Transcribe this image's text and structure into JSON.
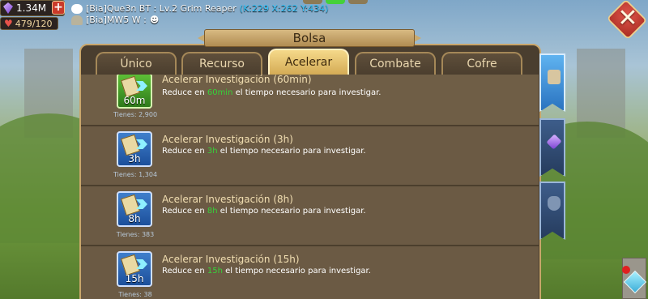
{
  "hud": {
    "gems_value": "1.34M",
    "stamina_value": "479/120"
  },
  "chat": [
    {
      "user": "[Bia]Que3n BT :",
      "message": "Lv.2 Grim Reaper",
      "coords": "(K:229 X:262 Y:434)"
    },
    {
      "user": "[Bia]MW5 W :",
      "message": ""
    }
  ],
  "window": {
    "title": "Bolsa"
  },
  "tabs": [
    {
      "label": "Único",
      "active": false
    },
    {
      "label": "Recurso",
      "active": false
    },
    {
      "label": "Acelerar",
      "active": true
    },
    {
      "label": "Combate",
      "active": false
    },
    {
      "label": "Cofre",
      "active": false
    }
  ],
  "items": [
    {
      "title": "Acelerar Investigación (60min)",
      "desc_prefix": "Reduce en ",
      "duration": "60min",
      "desc_suffix": " el tiempo necesario para investigar.",
      "icon_label": "60m",
      "have": "Tienes: 2,900",
      "icon_color": "green"
    },
    {
      "title": "Acelerar Investigación (3h)",
      "desc_prefix": "Reduce en ",
      "duration": "3h",
      "desc_suffix": " el tiempo necesario para investigar.",
      "icon_label": "3h",
      "have": "Tienes: 1,304",
      "icon_color": "blue"
    },
    {
      "title": "Acelerar Investigación (8h)",
      "desc_prefix": "Reduce en ",
      "duration": "8h",
      "desc_suffix": " el tiempo necesario para investigar.",
      "icon_label": "8h",
      "have": "Tienes: 383",
      "icon_color": "blue"
    },
    {
      "title": "Acelerar Investigación (15h)",
      "desc_prefix": "Reduce en ",
      "duration": "15h",
      "desc_suffix": " el tiempo necesario para investigar.",
      "icon_label": "15h",
      "have": "Tienes: 38",
      "icon_color": "blue"
    }
  ],
  "side_tabs": [
    {
      "icon": "bag-icon",
      "active": true
    },
    {
      "icon": "gem-icon",
      "active": false
    },
    {
      "icon": "shield-icon",
      "active": false
    }
  ],
  "colors": {
    "highlight": "#37d23a",
    "coords": "#38c7ff",
    "panel": "#4a3e2f",
    "tab_active": "#d4ab55"
  }
}
